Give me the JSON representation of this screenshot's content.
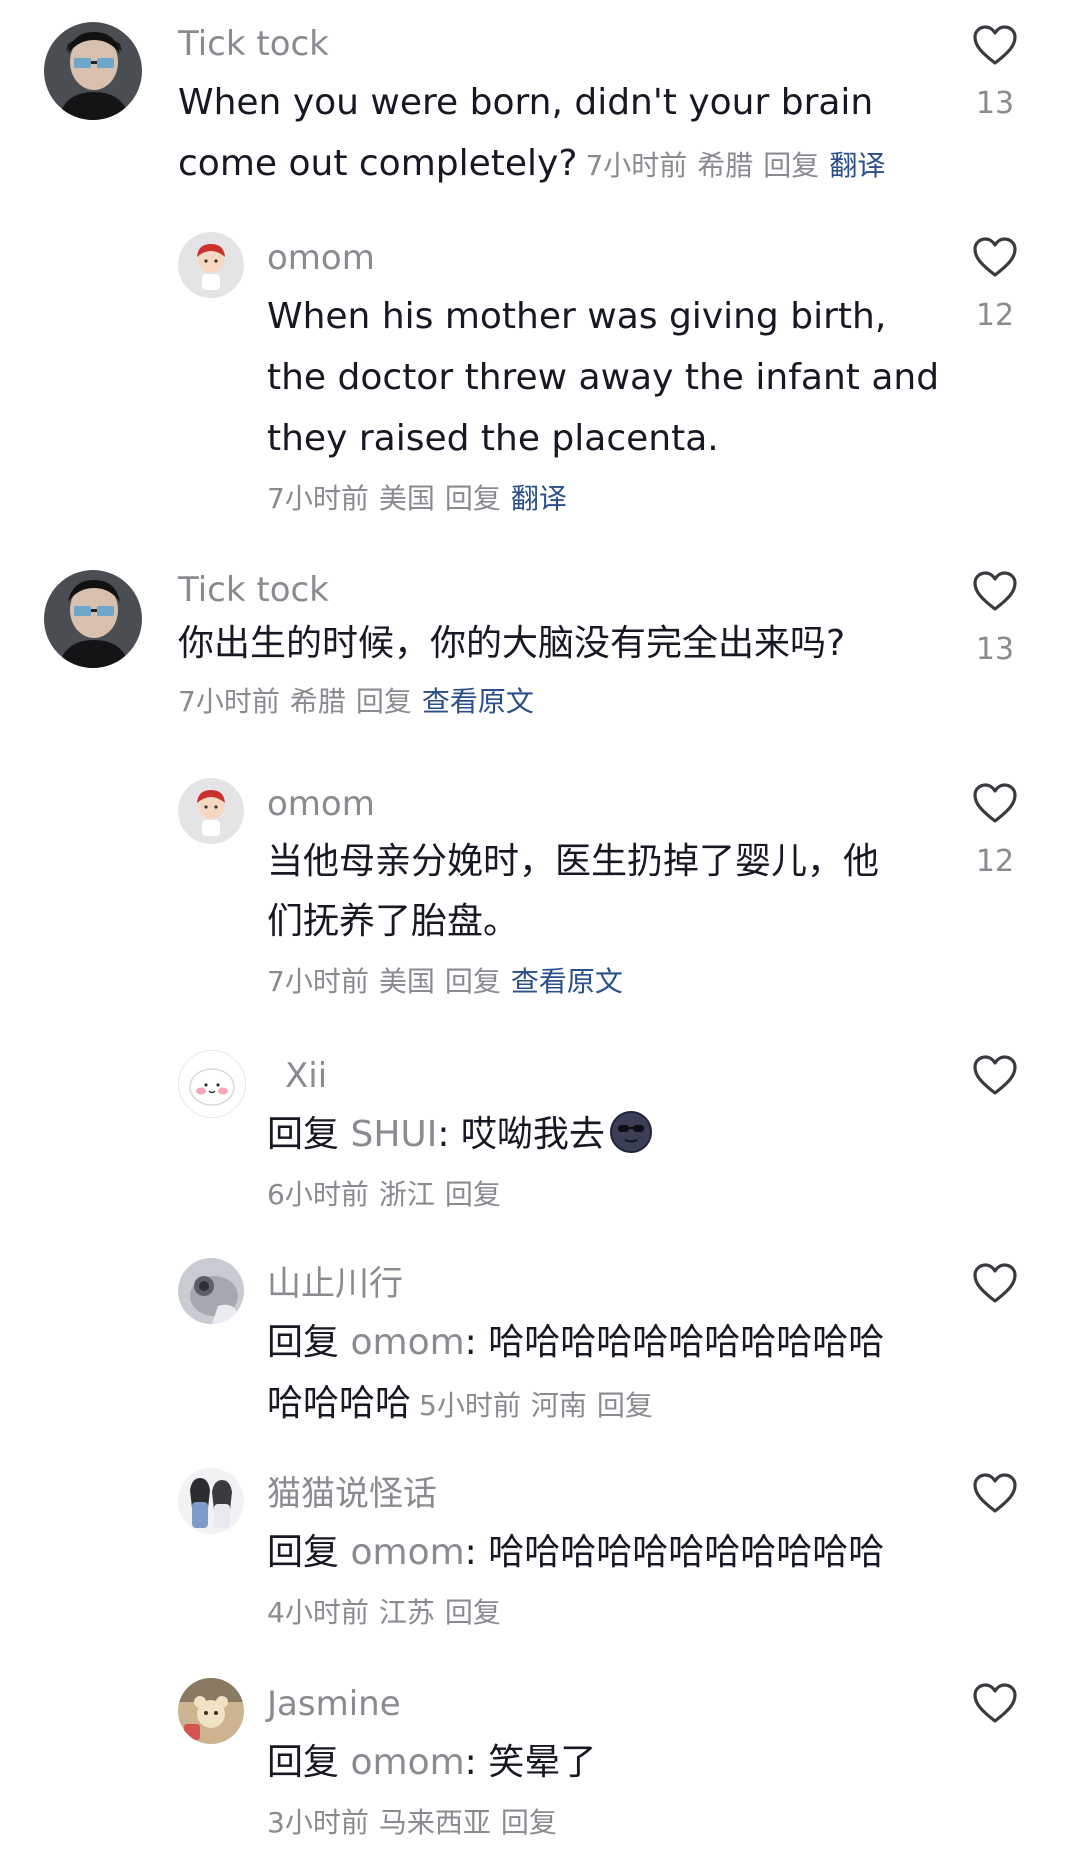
{
  "comments": [
    {
      "username": "Tick tock",
      "text_line1": "When you were born, didn't your brain",
      "text_line2": "come out completely?",
      "time": "7小时前",
      "location": "希腊",
      "reply": "回复",
      "action": "翻译",
      "likes": "13"
    },
    {
      "username": "omom",
      "text_line1": "When his mother was giving birth,",
      "text_line2": "the doctor threw away the infant and",
      "text_line3": "they raised the placenta.",
      "time": "7小时前",
      "location": "美国",
      "reply": "回复",
      "action": "翻译",
      "likes": "12"
    },
    {
      "username": "Tick tock",
      "text": "你出生的时候，你的大脑没有完全出来吗?",
      "time": "7小时前",
      "location": "希腊",
      "reply": "回复",
      "action": "查看原文",
      "likes": "13"
    },
    {
      "username": "omom",
      "text_line1": "当他母亲分娩时，医生扔掉了婴儿，他",
      "text_line2": "们抚养了胎盘。",
      "time": "7小时前",
      "location": "美国",
      "reply": "回复",
      "action": "查看原文",
      "likes": "12"
    },
    {
      "username": "Xii",
      "reply_prefix": "回复",
      "reply_to": "SHUI",
      "text": ": 哎呦我去",
      "emoji": "sunglasses-moon-emoji",
      "time": "6小时前",
      "location": "浙江",
      "reply": "回复"
    },
    {
      "username": "山止川行",
      "reply_prefix": "回复",
      "reply_to": "omom",
      "text_line1": ": 哈哈哈哈哈哈哈哈哈哈哈",
      "text_line2": "哈哈哈哈",
      "time": "5小时前",
      "location": "河南",
      "reply": "回复"
    },
    {
      "username": "猫猫说怪话",
      "reply_prefix": "回复",
      "reply_to": "omom",
      "text": ": 哈哈哈哈哈哈哈哈哈哈哈",
      "time": "4小时前",
      "location": "江苏",
      "reply": "回复"
    },
    {
      "username": "Jasmine",
      "reply_prefix": "回复",
      "reply_to": "omom",
      "text": ": 笑晕了",
      "time": "3小时前",
      "location": "马来西亚",
      "reply": "回复"
    }
  ],
  "colors": {
    "text": "#161823",
    "secondary": "#8a8b91",
    "link": "#2a4f8a",
    "heart_stroke": "#3a3b40"
  }
}
